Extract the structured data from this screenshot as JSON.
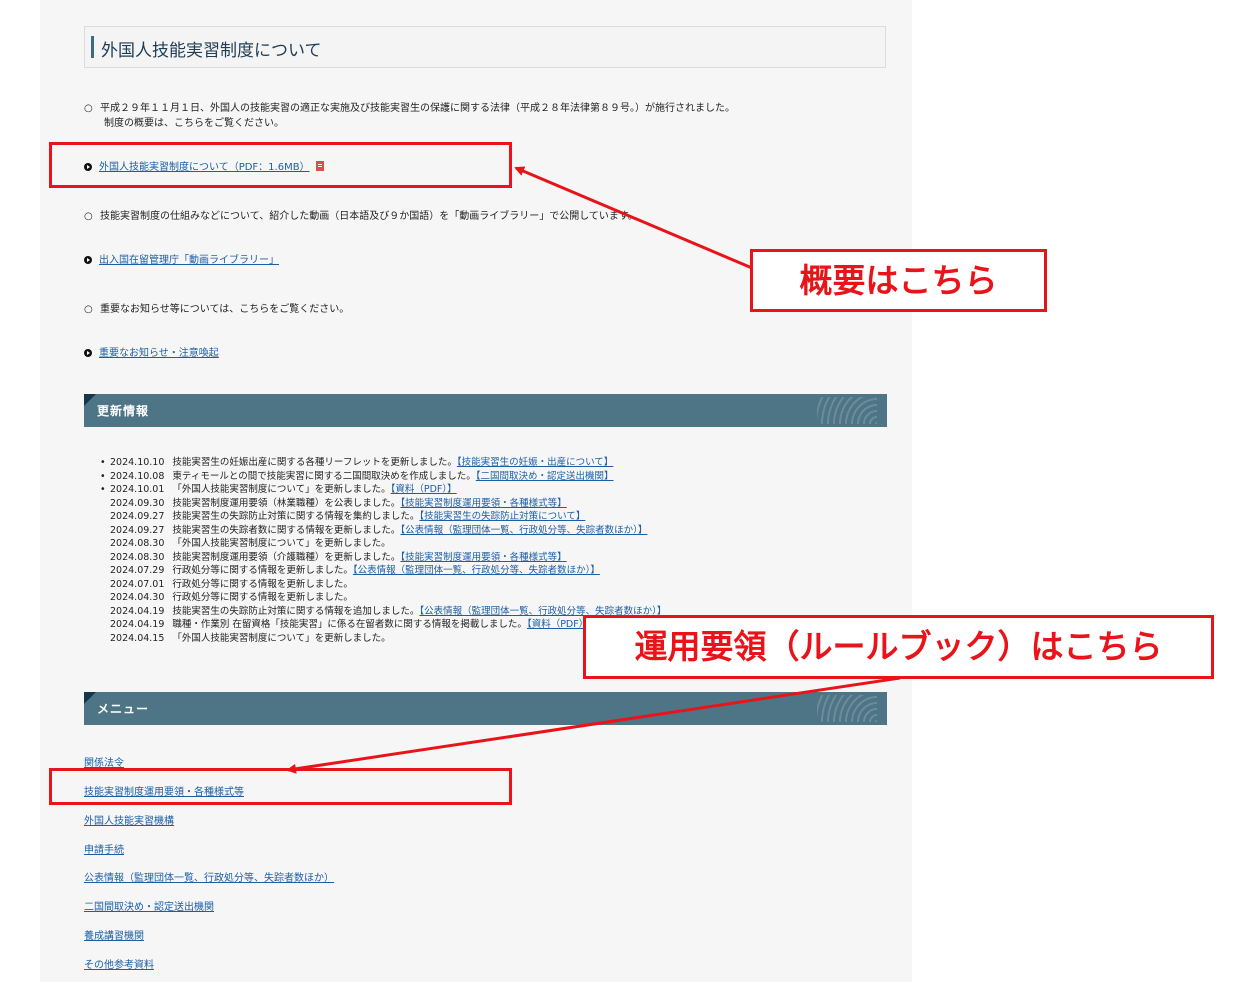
{
  "page_title": "外国人技能実習制度について",
  "intro": {
    "line1": "平成２９年１１月１日、外国人の技能実習の適正な実施及び技能実習生の保護に関する法律（平成２８年法律第８９号。）が施行されました。",
    "line2": "制度の概要は、こちらをご覧ください。"
  },
  "overview_link": "外国人技能実習制度について（PDF：1.6MB）",
  "video_text": "技能実習制度の仕組みなどについて、紹介した動画（日本語及び９か国語）を「動画ライブラリー」で公開しています。",
  "video_link": "出入国在留管理庁「動画ライブラリー」",
  "notice_text": "重要なお知らせ等については、こちらをご覧ください。",
  "notice_link": "重要なお知らせ・注意喚起",
  "updates": {
    "heading": "更新情報",
    "items": [
      {
        "date": "2024.10.10",
        "text": "技能実習生の妊娠出産に関する各種リーフレットを更新しました。",
        "link": "【技能実習生の妊娠・出産について】",
        "bullet": true
      },
      {
        "date": "2024.10.08",
        "text": "東ティモールとの間で技能実習に関する二国間取決めを作成しました。",
        "link": "【二国間取決め・認定送出機関】",
        "bullet": true
      },
      {
        "date": "2024.10.01",
        "text": "「外国人技能実習制度について」を更新しました。",
        "link": "【資料（PDF）】",
        "bullet": true
      },
      {
        "date": "2024.09.30",
        "text": "技能実習制度運用要領（林業職種）を公表しました。",
        "link": "【技能実習制度運用要領・各種様式等】",
        "bullet": false
      },
      {
        "date": "2024.09.27",
        "text": "技能実習生の失踪防止対策に関する情報を集約しました。",
        "link": "【技能実習生の失踪防止対策について】",
        "bullet": false
      },
      {
        "date": "2024.09.27",
        "text": "技能実習生の失踪者数に関する情報を更新しました。",
        "link": "【公表情報（監理団体一覧、行政処分等、失踪者数ほか）】",
        "bullet": false
      },
      {
        "date": "2024.08.30",
        "text": "「外国人技能実習制度について」を更新しました。",
        "link": "",
        "bullet": false
      },
      {
        "date": "2024.08.30",
        "text": "技能実習制度運用要領（介護職種）を更新しました。",
        "link": "【技能実習制度運用要領・各種様式等】",
        "bullet": false
      },
      {
        "date": "2024.07.29",
        "text": "行政処分等に関する情報を更新しました。",
        "link": "【公表情報（監理団体一覧、行政処分等、失踪者数ほか）】",
        "bullet": false
      },
      {
        "date": "2024.07.01",
        "text": "行政処分等に関する情報を更新しました。",
        "link": "",
        "bullet": false
      },
      {
        "date": "2024.04.30",
        "text": "行政処分等に関する情報を更新しました。",
        "link": "",
        "bullet": false
      },
      {
        "date": "2024.04.19",
        "text": "技能実習生の失踪防止対策に関する情報を追加しました。",
        "link": "【公表情報（監理団体一覧、行政処分等、失踪者数ほか）】",
        "bullet": false
      },
      {
        "date": "2024.04.19",
        "text": "職種・作業別 在留資格「技能実習」に係る在留者数に関する情報を掲載しました。",
        "link": "【資料（PDF）】",
        "bullet": false
      },
      {
        "date": "2024.04.15",
        "text": "「外国人技能実習制度について」を更新しました。",
        "link": "",
        "bullet": false
      }
    ]
  },
  "menu": {
    "heading": "メニュー",
    "items": [
      "関係法令",
      "技能実習制度運用要領・各種様式等",
      "外国人技能実習機構",
      "申請手続",
      "公表情報（監理団体一覧、行政処分等、失踪者数ほか）",
      "二国間取決め・認定送出機関",
      "養成講習機関",
      "その他参考資料"
    ]
  },
  "callouts": {
    "overview": "概要はこちら",
    "rulebook": "運用要領（ルールブック）はこちら"
  },
  "colors": {
    "annotation_red": "#e8141a",
    "band_teal": "#4e7586",
    "link_blue": "#1d5fa6"
  }
}
